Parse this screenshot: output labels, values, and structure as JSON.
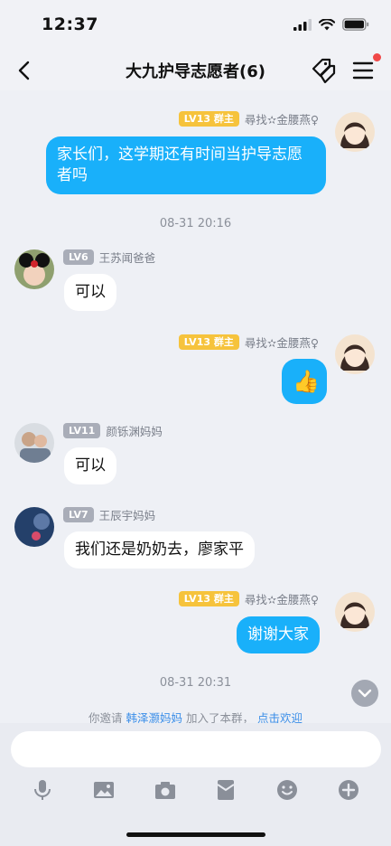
{
  "status_bar": {
    "time": "12:37"
  },
  "nav": {
    "title": "大九护导志愿者(6)"
  },
  "messages": {
    "m1": {
      "level": "LV13",
      "role": "群主",
      "sender": "尋找✫金腰燕♀",
      "text": "家长们，这学期还有时间当护导志愿者吗"
    },
    "ts1": "08-31 20:16",
    "m2": {
      "level": "LV6",
      "sender": "王苏闻爸爸",
      "text": "可以"
    },
    "m3": {
      "level": "LV13",
      "role": "群主",
      "sender": "尋找✫金腰燕♀",
      "sticker": "👍"
    },
    "m4": {
      "level": "LV11",
      "sender": "颜铄渊妈妈",
      "text": "可以"
    },
    "m5": {
      "level": "LV7",
      "sender": "王辰宇妈妈",
      "text": "我们还是奶奶去，廖家平"
    },
    "m6": {
      "level": "LV13",
      "role": "群主",
      "sender": "尋找✫金腰燕♀",
      "text": "谢谢大家"
    },
    "ts2": "08-31 20:31"
  },
  "system_note": {
    "prefix": "你邀请",
    "name": "韩泽灏妈妈",
    "middle": "加入了本群，",
    "link": "点击欢迎"
  },
  "input": {
    "placeholder": ""
  },
  "toolbar": [
    "mic-icon",
    "image-icon",
    "camera-icon",
    "red-packet-icon",
    "emoji-icon",
    "plus-icon"
  ],
  "colors": {
    "accent": "#19b0fa",
    "link": "#3b8ee8",
    "badge_owner": "#f6c33c",
    "badge_member": "#a9adb8",
    "notify": "#f04848"
  }
}
